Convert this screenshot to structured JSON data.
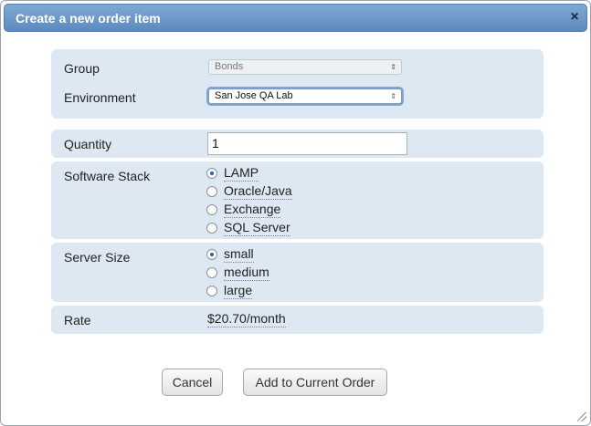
{
  "dialog": {
    "title": "Create a new order item",
    "close_glyph": "×"
  },
  "form": {
    "group": {
      "label": "Group",
      "value": "Bonds"
    },
    "environment": {
      "label": "Environment",
      "value": "San Jose QA Lab"
    },
    "quantity": {
      "label": "Quantity",
      "value": "1"
    },
    "software_stack": {
      "label": "Software Stack",
      "options": [
        {
          "label": "LAMP",
          "checked": true
        },
        {
          "label": "Oracle/Java",
          "checked": false
        },
        {
          "label": "Exchange",
          "checked": false
        },
        {
          "label": "SQL Server",
          "checked": false
        }
      ]
    },
    "server_size": {
      "label": "Server Size",
      "options": [
        {
          "label": "small",
          "checked": true
        },
        {
          "label": "medium",
          "checked": false
        },
        {
          "label": "large",
          "checked": false
        }
      ]
    },
    "rate": {
      "label": "Rate",
      "value": "$20.70/month"
    }
  },
  "buttons": {
    "cancel_label": "Cancel",
    "add_label": "Add to Current Order"
  },
  "select_arrows": "⇕"
}
